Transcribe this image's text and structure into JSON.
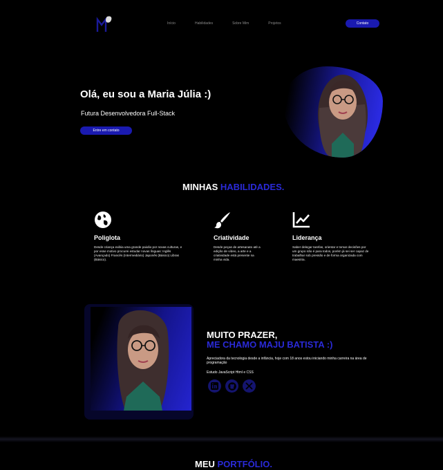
{
  "nav": {
    "links": [
      "Início",
      "Habilidades",
      "Sobre Mim",
      "Projetos"
    ],
    "contact_label": "Contato"
  },
  "hero": {
    "title": "Olá, eu sou a Maria Júlia :)",
    "subtitle": "Futura Desenvolvedora Full-Stack",
    "button_label": "Entre em contato"
  },
  "skills": {
    "title_white": "MINHAS",
    "title_accent": "HABILIDADES.",
    "items": [
      {
        "icon": "globe-icon",
        "name": "Poliglota",
        "desc": "Desde criança exibia uma grande paixão por novas culturas, e por esse motivo procurei estudar novas línguas: Inglês (Avançado) Francês (Intermediário) Japonês (Básico) Libras (Básico)."
      },
      {
        "icon": "paintbrush-icon",
        "name": "Criatividade",
        "desc": "Desde peças de artesanato até a edição de vídeo, a arte e a criatividade está presente na minha vida."
      },
      {
        "icon": "chart-line-icon",
        "name": "Liderança",
        "desc": "Saber delegar tarefas, orientar e tomar decisões por um grupo não é para todos, porém já sei ser capaz de trabalhar sob pressão e de forma organizada com maestria."
      }
    ]
  },
  "about": {
    "heading_line1": "MUITO PRAZER,",
    "heading_line2": "ME CHAMO MAJU BATISTA :)",
    "paragraph": "Apreciadora da tecnologia desde a infância, hoje com 18 anos estou iniciando minha carreira na área de programação",
    "studying": "Estudo JavaScript Html e CSS",
    "socials": [
      "linkedin-icon",
      "github-icon",
      "x-icon"
    ]
  },
  "portfolio": {
    "title_white": "MEU",
    "title_accent": "PORTFÓLIO."
  },
  "colors": {
    "accent": "#2a2ad8",
    "button": "#1a1ab0",
    "background": "#000000"
  }
}
